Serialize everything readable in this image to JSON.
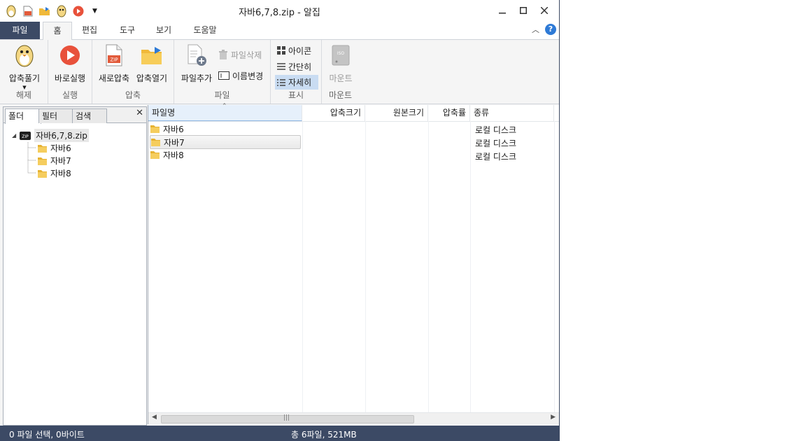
{
  "window": {
    "title": "자바6,7,8.zip - 알집"
  },
  "menu_tabs": [
    "파일",
    "홈",
    "편집",
    "도구",
    "보기",
    "도움말"
  ],
  "ribbon": {
    "extract": {
      "button": "압축풀기",
      "group": "해제"
    },
    "run": {
      "button": "바로실행",
      "group": "실행"
    },
    "compress": {
      "new_button": "새로압축",
      "open_button": "압축열기",
      "group": "압축"
    },
    "file": {
      "add_button": "파일추가",
      "delete_button": "파일삭제",
      "rename_button": "이름변경",
      "group": "파일"
    },
    "view": {
      "icon_button": "아이콘",
      "simple_button": "간단히",
      "detail_button": "자세히",
      "group": "표시"
    },
    "mount": {
      "button": "마운트",
      "group": "마운트",
      "iso_text": "ISO"
    },
    "zip_text": "ZIP"
  },
  "left_panel": {
    "tabs": [
      "폴더",
      "필터",
      "검색"
    ],
    "close": "✕",
    "tree": {
      "root": "자바6,7,8.zip",
      "children": [
        "자바6",
        "자바7",
        "자바8"
      ]
    }
  },
  "file_list": {
    "columns": [
      "파일명",
      "압축크기",
      "원본크기",
      "압축률",
      "종류"
    ],
    "rows": [
      {
        "name": "자바6",
        "type": "로컬 디스크"
      },
      {
        "name": "자바7",
        "type": "로컬 디스크"
      },
      {
        "name": "자바8",
        "type": "로컬 디스크"
      }
    ],
    "selected_row": 1
  },
  "status": {
    "selection": "0 파일 선택,  0바이트",
    "total": "총 6파일,  521MB"
  },
  "colors": {
    "accent": "#3c4a65",
    "selected": "#c9dcf2",
    "run": "#e8513b",
    "folder": "#f0c24a"
  }
}
